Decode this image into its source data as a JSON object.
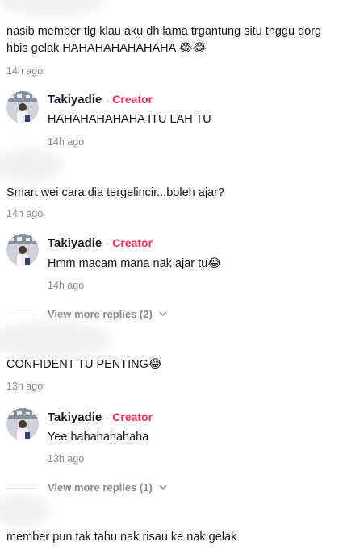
{
  "comments": [
    {
      "text": "nasib member tlg klau aku dh lama trgantung situ tnggu dorg hbis gelak HAHAHAHAHAHAHA",
      "emoji": "😂😂",
      "time": "14h ago"
    },
    {
      "text": "Smart wei cara dia tergelincir...boleh ajar?",
      "time": "14h ago"
    },
    {
      "text": "CONFIDENT TU PENTING",
      "emoji": "😂",
      "time": "13h ago"
    },
    {
      "text": "member pun tak tahu nak risau ke nak gelak"
    }
  ],
  "replies": [
    {
      "author": "Takiyadie",
      "badge": "Creator",
      "separator": "·",
      "text": "HAHAHAHAHAHA ITU LAH TU",
      "time": "14h ago"
    },
    {
      "author": "Takiyadie",
      "badge": "Creator",
      "separator": "·",
      "text": "Hmm macam mana nak ajar tu",
      "emoji": "😂",
      "time": "14h ago"
    },
    {
      "author": "Takiyadie",
      "badge": "Creator",
      "separator": "·",
      "text": "Yee hahahahahaha",
      "time": "13h ago"
    }
  ],
  "view_more": [
    {
      "label": "View more replies (2)",
      "icon": "chevron-down-icon"
    },
    {
      "label": "View more replies (1)",
      "icon": "chevron-down-icon"
    }
  ],
  "colors": {
    "creator_badge": "#fe2c55",
    "muted": "#8a8b91",
    "text": "#161823"
  }
}
